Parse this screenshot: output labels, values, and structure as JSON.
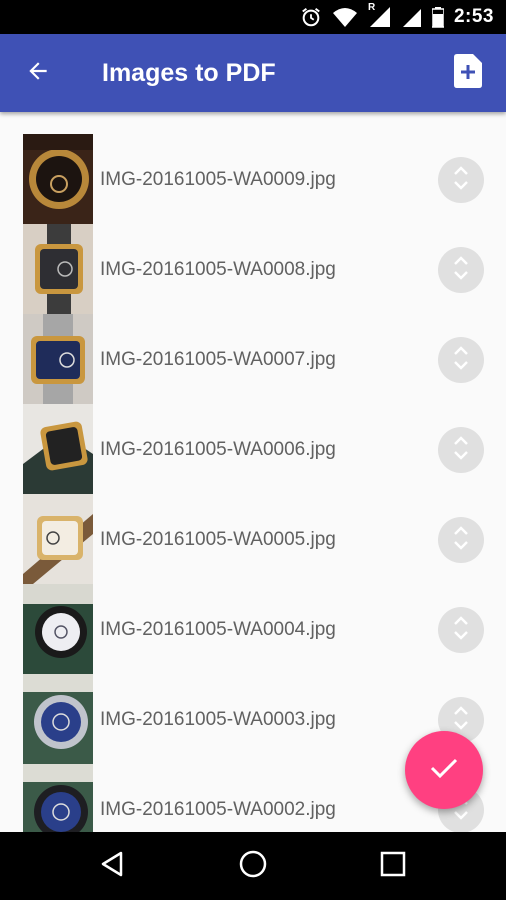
{
  "status_bar": {
    "time": "2:53",
    "icons": [
      "alarm-icon",
      "wifi-icon",
      "signal-roaming-icon",
      "signal-icon",
      "battery-icon"
    ],
    "roaming_label": "R"
  },
  "app_bar": {
    "title": "Images to PDF",
    "back_icon": "arrow-back-icon",
    "action_icon": "add-file-icon",
    "color": "#3f51b5"
  },
  "files": [
    {
      "name": "IMG-20161005-WA0009.jpg"
    },
    {
      "name": "IMG-20161005-WA0008.jpg"
    },
    {
      "name": "IMG-20161005-WA0007.jpg"
    },
    {
      "name": "IMG-20161005-WA0006.jpg"
    },
    {
      "name": "IMG-20161005-WA0005.jpg"
    },
    {
      "name": "IMG-20161005-WA0004.jpg"
    },
    {
      "name": "IMG-20161005-WA0003.jpg"
    },
    {
      "name": "IMG-20161005-WA0002.jpg"
    }
  ],
  "fab": {
    "icon": "check-icon",
    "color": "#ff4081"
  },
  "nav_bar": {
    "icons": [
      "back-triangle-icon",
      "home-circle-icon",
      "recents-square-icon"
    ]
  }
}
